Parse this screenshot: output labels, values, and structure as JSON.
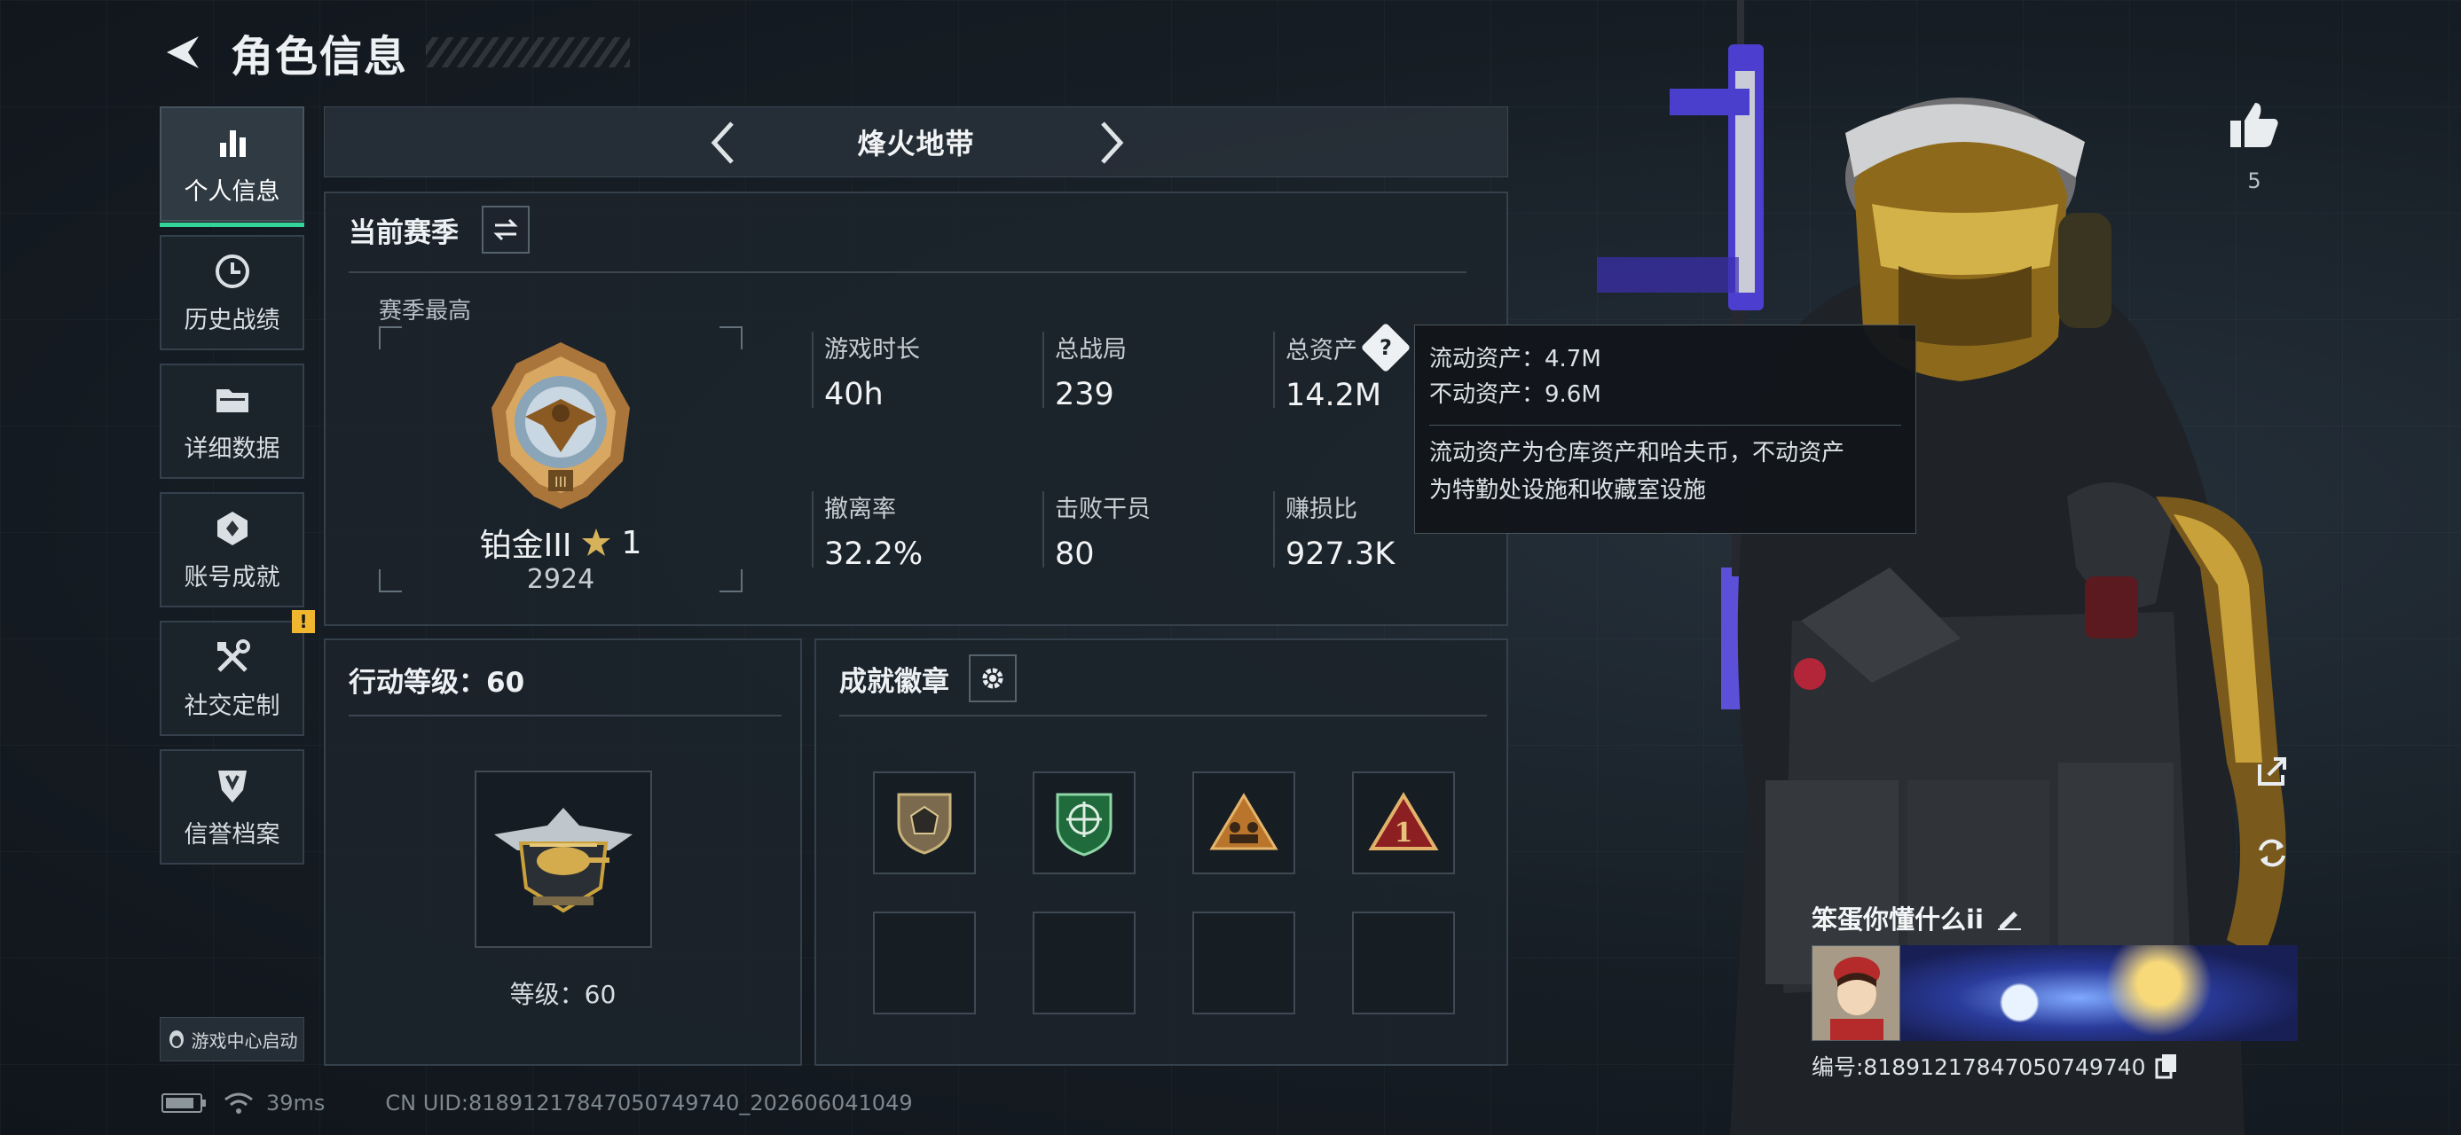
{
  "header": {
    "title": "角色信息"
  },
  "sidebar": {
    "items": [
      {
        "label": "个人信息",
        "icon": "bar-chart-icon",
        "active": true
      },
      {
        "label": "历史战绩",
        "icon": "clock-icon"
      },
      {
        "label": "详细数据",
        "icon": "folder-icon"
      },
      {
        "label": "账号成就",
        "icon": "crest-icon"
      },
      {
        "label": "社交定制",
        "icon": "tools-icon",
        "badge": "!"
      },
      {
        "label": "信誉档案",
        "icon": "shield-icon"
      }
    ],
    "launch_badge": "游戏中心启动"
  },
  "mode_selector": {
    "title": "烽火地带"
  },
  "season": {
    "title": "当前赛季",
    "best_label": "赛季最高",
    "rank_name": "铂金III",
    "rank_star_count": "1",
    "rank_score": "2924",
    "stats": [
      {
        "label": "游戏时长",
        "value": "40h"
      },
      {
        "label": "总战局",
        "value": "239"
      },
      {
        "label": "总资产",
        "value": "14.2M",
        "help": "?"
      },
      {
        "label": "撤离率",
        "value": "32.2%"
      },
      {
        "label": "击败干员",
        "value": "80"
      },
      {
        "label": "赚损比",
        "value": "927.3K"
      }
    ]
  },
  "tooltip": {
    "liquid": "流动资产：4.7M",
    "fixed": "不动资产：9.6M",
    "note_line1": "流动资产为仓库资产和哈夫币，不动资产",
    "note_line2": "为特勤处设施和收藏室设施"
  },
  "level": {
    "title": "行动等级：60",
    "label": "等级：60"
  },
  "achievements": {
    "title": "成就徽章",
    "badges": [
      "shield-d20-badge",
      "green-crosshair-badge",
      "orange-team-badge",
      "red-number-one-badge"
    ],
    "empty_slots": 4
  },
  "like": {
    "count": "5"
  },
  "player": {
    "name": "笨蛋你懂什么ii",
    "id_text": "编号:8189121784705074974​0"
  },
  "status_bar": {
    "ping": "39ms",
    "uid": "CN UID:8189121784705074974​0_202606041049"
  },
  "colors": {
    "accent": "#33d39a",
    "warning": "#f0b630",
    "purple": "#5b4ad6",
    "gold": "#c9a13b"
  }
}
